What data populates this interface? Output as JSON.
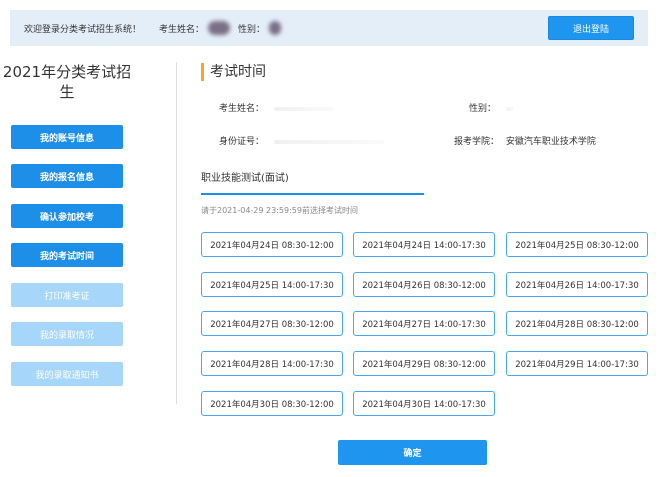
{
  "header": {
    "welcome": "欢迎登录分类考试招生系统！",
    "name_label": "考生姓名：",
    "gender_label": "性别：",
    "logout_label": "退出登陆"
  },
  "sidebar": {
    "title": "2021年分类考试招生",
    "items": [
      {
        "label": "我的账号信息",
        "state": "enabled"
      },
      {
        "label": "我的报名信息",
        "state": "enabled"
      },
      {
        "label": "确认参加校考",
        "state": "enabled"
      },
      {
        "label": "我的考试时间",
        "state": "enabled"
      },
      {
        "label": "打印准考证",
        "state": "disabled"
      },
      {
        "label": "我的录取情况",
        "state": "disabled"
      },
      {
        "label": "我的录取通知书",
        "state": "disabled"
      }
    ]
  },
  "main": {
    "title": "考试时间",
    "info": {
      "name_label": "考生姓名：",
      "gender_label": "性别：",
      "id_label": "身份证号：",
      "school_label": "报考学院：",
      "school_value": "安徽汽车职业技术学院"
    },
    "subtitle": "职业技能测试(面试)",
    "hint": "请于2021-04-29 23:59:59前选择考试时间",
    "slots": [
      "2021年04月24日 08:30-12:00",
      "2021年04月24日 14:00-17:30",
      "2021年04月25日 08:30-12:00",
      "2021年04月25日 14:00-17:30",
      "2021年04月26日 08:30-12:00",
      "2021年04月26日 14:00-17:30",
      "2021年04月27日 08:30-12:00",
      "2021年04月27日 14:00-17:30",
      "2021年04月28日 08:30-12:00",
      "2021年04月28日 14:00-17:30",
      "2021年04月29日 08:30-12:00",
      "2021年04月29日 14:00-17:30",
      "2021年04月30日 08:30-12:00",
      "2021年04月30日 14:00-17:30"
    ],
    "confirm_label": "确定"
  },
  "colors": {
    "primary": "#1e96f0",
    "disabled": "#a6d6f9",
    "accent": "#f3a532",
    "topbar_bg": "#e4eef9"
  }
}
